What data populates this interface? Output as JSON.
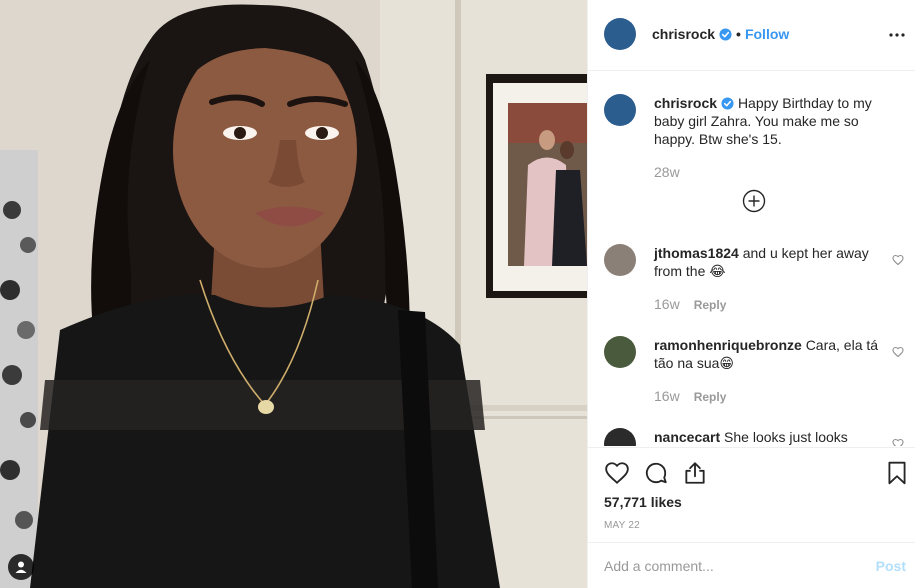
{
  "post": {
    "username": "chrisrock",
    "verified": true,
    "separator": "•",
    "follow_label": "Follow"
  },
  "caption": {
    "username": "chrisrock",
    "text": "Happy Birthday to my baby girl Zahra. You make me so happy. Btw she's 15.",
    "age": "28w"
  },
  "comments": [
    {
      "username": "jthomas1824",
      "text": "and u kept her away from the 😂",
      "age": "16w",
      "reply_label": "Reply"
    },
    {
      "username": "ramonhenriquebronze",
      "text": "Cara, ela tá tão na sua😁",
      "age": "16w",
      "reply_label": "Reply"
    },
    {
      "username": "nancecart",
      "text": "She looks just looks"
    }
  ],
  "likes": "57,771 likes",
  "date": "MAY 22",
  "comment_box": {
    "placeholder": "Add a comment...",
    "post_label": "Post"
  },
  "colors": {
    "accent": "#3897f0",
    "post_disabled": "#b2dffc",
    "avatar": "#2c5d8f",
    "muted": "#999999"
  },
  "icons": [
    "user-tag-icon",
    "verified-badge-icon",
    "more-options-icon",
    "add-circle-icon",
    "heart-icon",
    "comment-icon",
    "share-icon",
    "bookmark-icon"
  ]
}
